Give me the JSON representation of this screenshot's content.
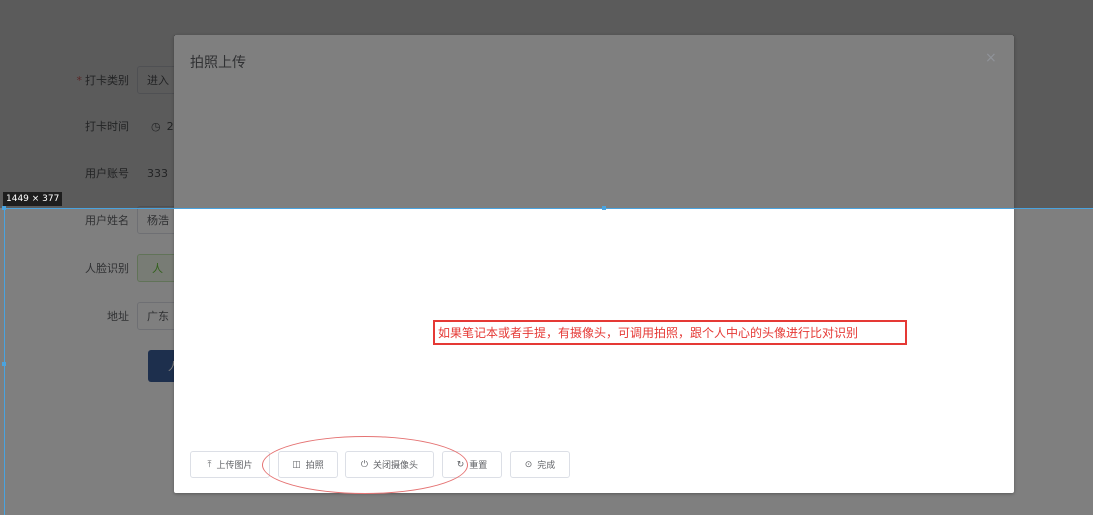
{
  "form": {
    "type_label": "打卡类别",
    "type_value": "进入",
    "time_label": "打卡时间",
    "time_value": "2",
    "account_label": "用户账号",
    "account_value": "333",
    "name_label": "用户姓名",
    "name_value": "杨浩",
    "face_label": "人脸识别",
    "face_button": "人",
    "address_label": "地址",
    "address_value": "广东",
    "submit_label": "人"
  },
  "dialog": {
    "title": "拍照上传",
    "close_glyph": "×"
  },
  "devtools": {
    "size_badge": "1449 × 377"
  },
  "annotation": {
    "note": "如果笔记本或者手提，有摄像头，可调用拍照，跟个人中心的头像进行比对识别"
  },
  "footer": {
    "upload": "上传图片",
    "photo": "拍照",
    "close_camera": "关闭摄像头",
    "reset": "重置",
    "done": "完成"
  },
  "icons": {
    "upload": "upload-icon",
    "camera": "camera-icon",
    "power": "power-icon",
    "refresh": "refresh-icon",
    "check": "check-circle-icon",
    "close": "close-icon",
    "clock": "clock-icon"
  }
}
